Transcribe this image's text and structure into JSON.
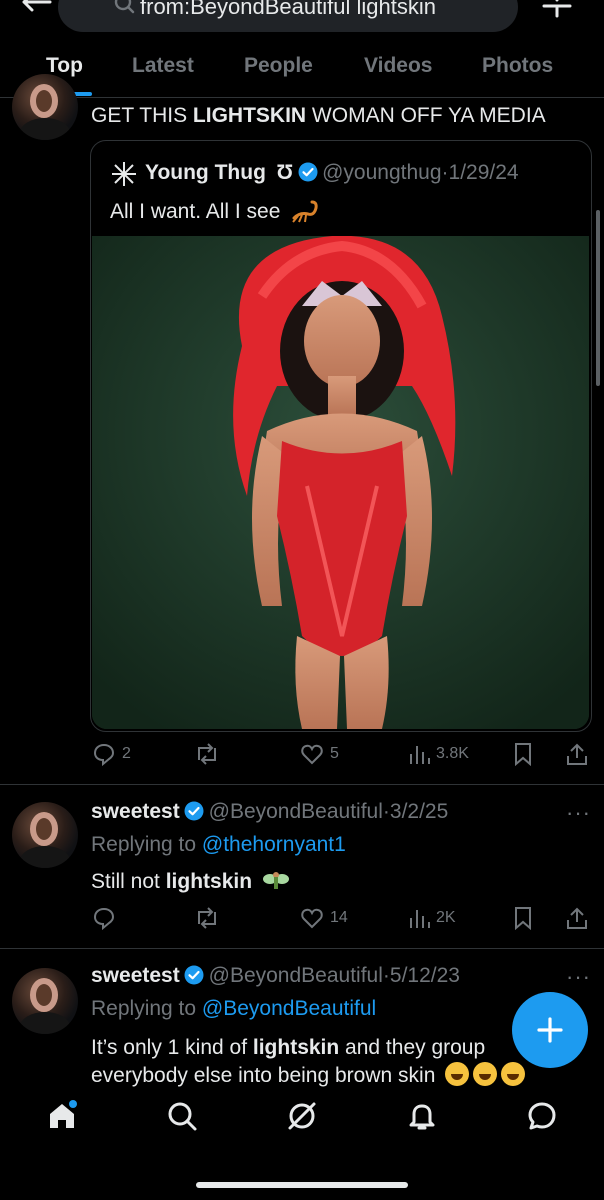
{
  "search": {
    "query": "from:BeyondBeautiful lightskin"
  },
  "tabs": [
    {
      "label": "Top"
    },
    {
      "label": "Latest"
    },
    {
      "label": "People"
    },
    {
      "label": "Videos"
    },
    {
      "label": "Photos"
    }
  ],
  "post1": {
    "text_pre": "GET THIS ",
    "text_bold": "LIGHTSKIN",
    "text_post": " WOMAN OFF YA MEDIA",
    "quote": {
      "name": "Young Thug",
      "name_symbol": "Ʊ",
      "handle": "@youngthug",
      "sep": "·",
      "date": "1/29/24",
      "text": "All I want. All I see"
    },
    "actions": {
      "replies": "2",
      "retweets": "",
      "likes": "5",
      "views": "3.8K"
    }
  },
  "post2": {
    "name": "sweetest",
    "handle": "@BeyondBeautiful",
    "sep": "·",
    "date": "3/2/25",
    "replying_to_label": "Replying to ",
    "replying_to_handle": "@thehornyant1",
    "text_pre": "Still not ",
    "text_bold": "lightskin",
    "actions": {
      "replies": "",
      "retweets": "",
      "likes": "14",
      "views": "2K"
    }
  },
  "post3": {
    "name": "sweetest",
    "handle": "@BeyondBeautiful",
    "sep": "·",
    "date": "5/12/23",
    "replying_to_label": "Replying to ",
    "replying_to_handle": "@BeyondBeautiful",
    "line1_pre": "It’s only 1 kind of ",
    "line1_bold": "lightskin",
    "line1_post": " and they group",
    "line2": "everybody else into being brown skin"
  },
  "more_label": "···",
  "colors": {
    "accent": "#1d9bf0",
    "muted": "#71767b",
    "text": "#e7e9ea",
    "background": "#000000"
  },
  "icons": [
    "back-arrow-icon",
    "search-icon",
    "settings-icon",
    "verified-icon",
    "reply-icon",
    "retweet-icon",
    "like-icon",
    "views-icon",
    "bookmark-icon",
    "share-icon",
    "compose-icon",
    "home-icon",
    "grok-icon",
    "notifications-icon",
    "messages-icon"
  ]
}
